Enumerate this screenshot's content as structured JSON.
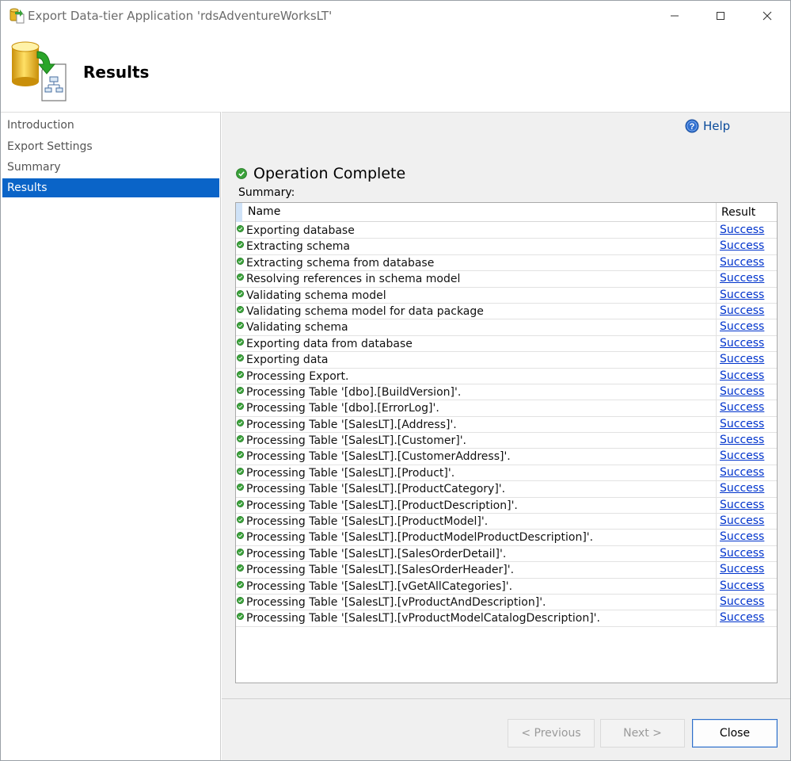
{
  "window": {
    "title": "Export Data-tier Application 'rdsAdventureWorksLT'",
    "controls": {
      "minimize_icon": "minimize-icon",
      "maximize_icon": "maximize-icon",
      "close_icon": "close-icon"
    }
  },
  "header": {
    "title": "Results",
    "icon": "database-export-icon"
  },
  "sidebar": {
    "items": [
      {
        "label": "Introduction",
        "active": false
      },
      {
        "label": "Export Settings",
        "active": false
      },
      {
        "label": "Summary",
        "active": false
      },
      {
        "label": "Results",
        "active": true
      }
    ]
  },
  "main": {
    "help_label": "Help",
    "status": "Operation Complete",
    "summary_label": "Summary:",
    "table": {
      "columns": [
        "Name",
        "Result"
      ],
      "rows": [
        {
          "name": "Exporting database",
          "result": "Success"
        },
        {
          "name": "Extracting schema",
          "result": "Success"
        },
        {
          "name": "Extracting schema from database",
          "result": "Success"
        },
        {
          "name": "Resolving references in schema model",
          "result": "Success"
        },
        {
          "name": "Validating schema model",
          "result": "Success"
        },
        {
          "name": "Validating schema model for data package",
          "result": "Success"
        },
        {
          "name": "Validating schema",
          "result": "Success"
        },
        {
          "name": "Exporting data from database",
          "result": "Success"
        },
        {
          "name": "Exporting data",
          "result": "Success"
        },
        {
          "name": "Processing Export.",
          "result": "Success"
        },
        {
          "name": "Processing Table '[dbo].[BuildVersion]'.",
          "result": "Success"
        },
        {
          "name": "Processing Table '[dbo].[ErrorLog]'.",
          "result": "Success"
        },
        {
          "name": "Processing Table '[SalesLT].[Address]'.",
          "result": "Success"
        },
        {
          "name": "Processing Table '[SalesLT].[Customer]'.",
          "result": "Success"
        },
        {
          "name": "Processing Table '[SalesLT].[CustomerAddress]'.",
          "result": "Success"
        },
        {
          "name": "Processing Table '[SalesLT].[Product]'.",
          "result": "Success"
        },
        {
          "name": "Processing Table '[SalesLT].[ProductCategory]'.",
          "result": "Success"
        },
        {
          "name": "Processing Table '[SalesLT].[ProductDescription]'.",
          "result": "Success"
        },
        {
          "name": "Processing Table '[SalesLT].[ProductModel]'.",
          "result": "Success"
        },
        {
          "name": "Processing Table '[SalesLT].[ProductModelProductDescription]'.",
          "result": "Success"
        },
        {
          "name": "Processing Table '[SalesLT].[SalesOrderDetail]'.",
          "result": "Success"
        },
        {
          "name": "Processing Table '[SalesLT].[SalesOrderHeader]'.",
          "result": "Success"
        },
        {
          "name": "Processing Table '[SalesLT].[vGetAllCategories]'.",
          "result": "Success"
        },
        {
          "name": "Processing Table '[SalesLT].[vProductAndDescription]'.",
          "result": "Success"
        },
        {
          "name": "Processing Table '[SalesLT].[vProductModelCatalogDescription]'.",
          "result": "Success"
        }
      ]
    }
  },
  "footer": {
    "previous_label": "< Previous",
    "next_label": "Next >",
    "close_label": "Close"
  },
  "colors": {
    "accent": "#0a64c8",
    "success": "#3aa13a",
    "link": "#0033cc"
  }
}
